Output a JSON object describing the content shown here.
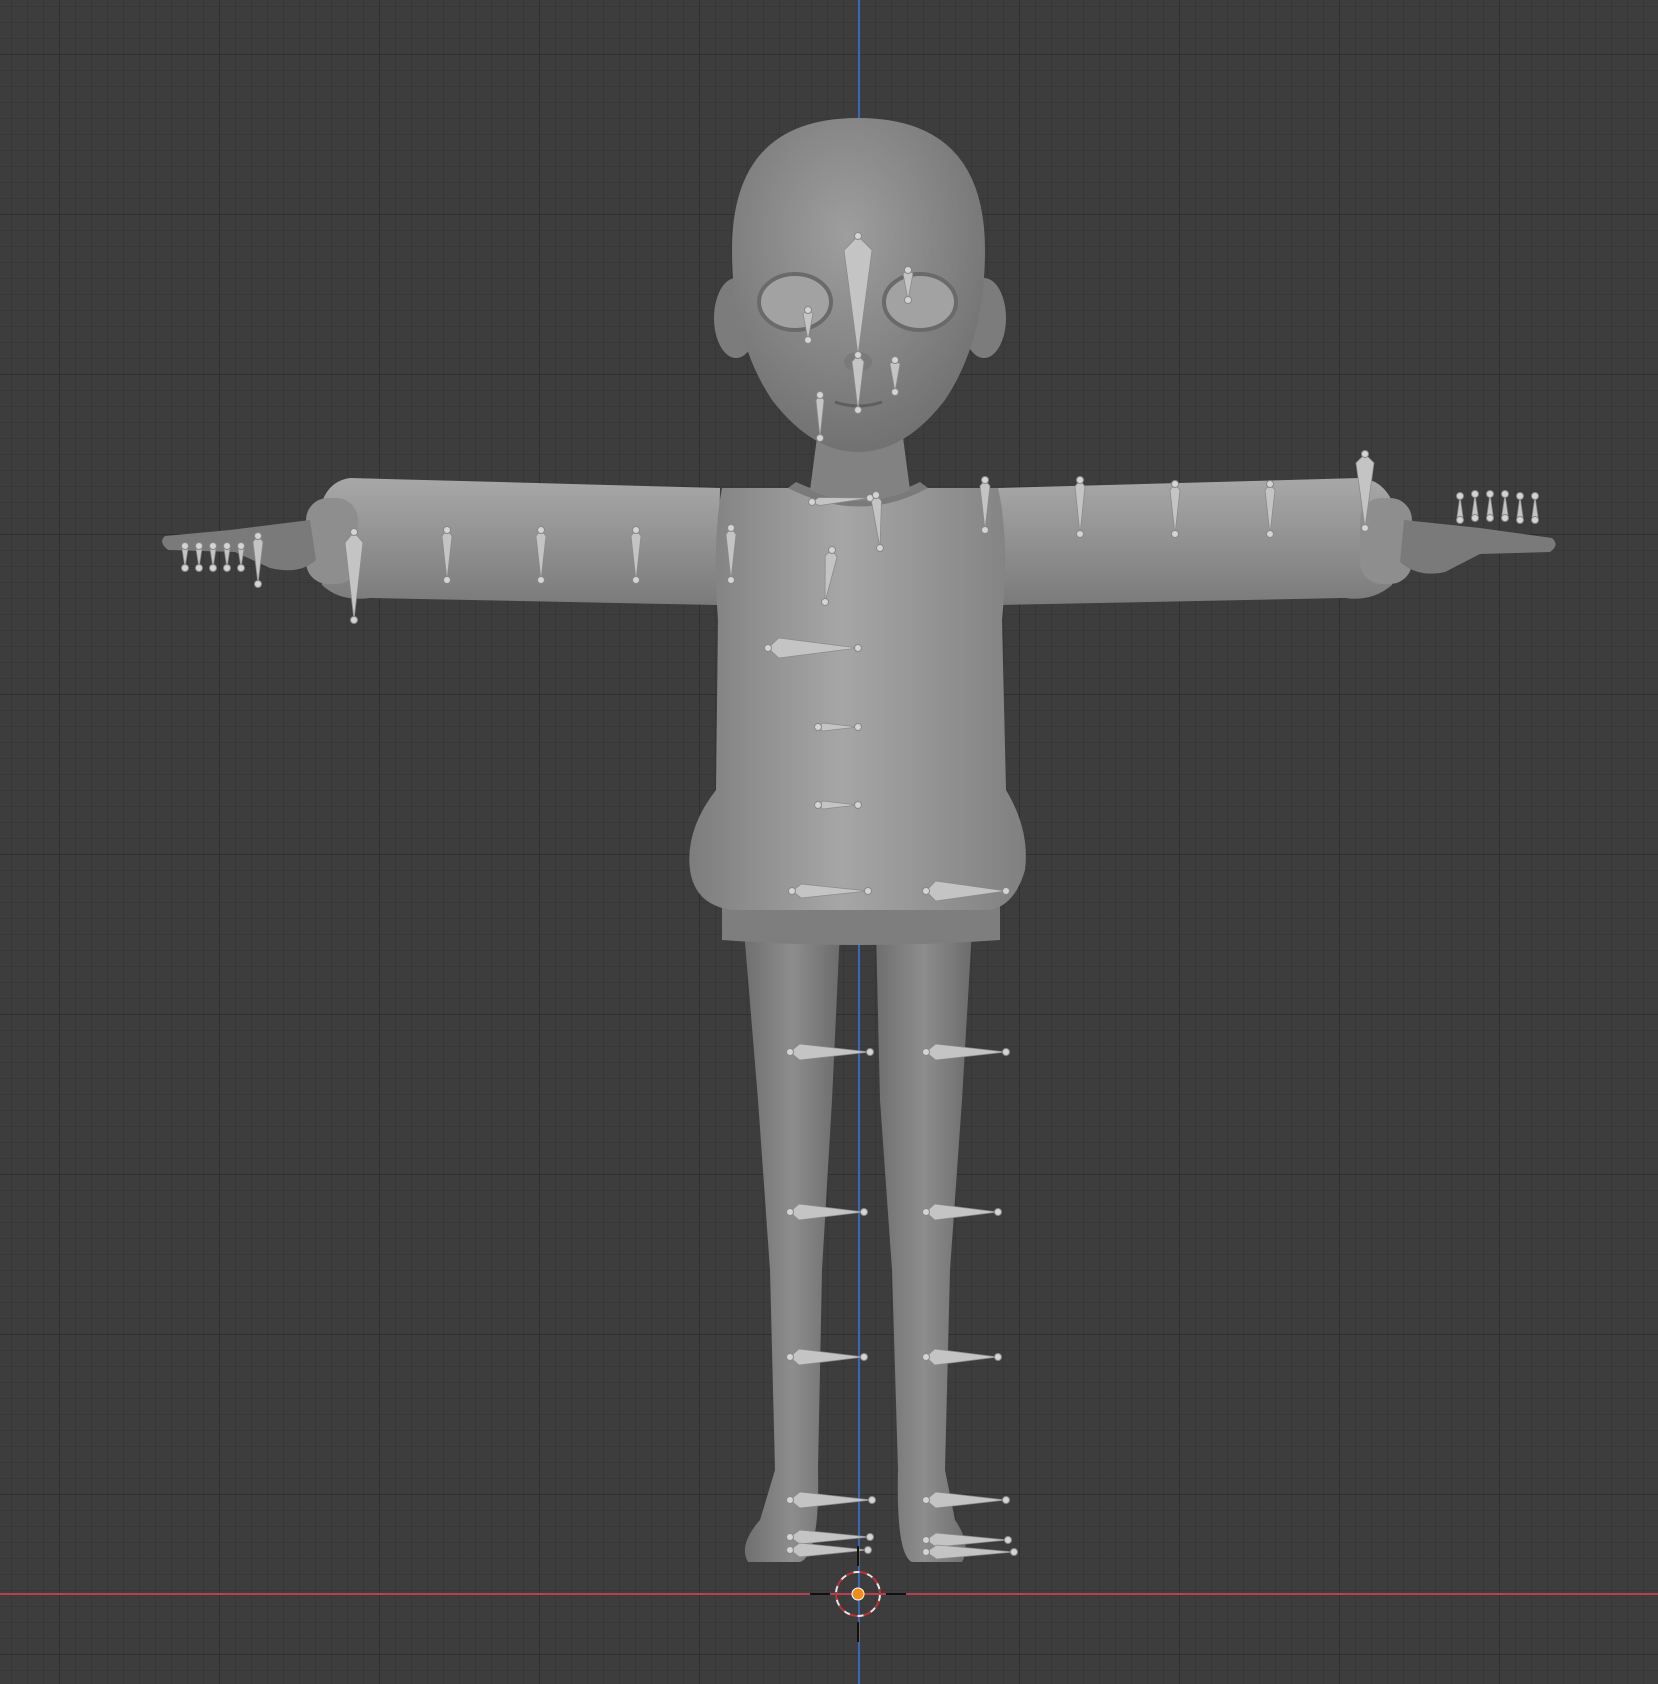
{
  "viewport": {
    "mode": "front-orthographic",
    "colors": {
      "background": "#3d3d3d",
      "axis_x": "#b34352",
      "axis_z": "#3a68b5",
      "cursor_center": "#f08c1a",
      "mesh": "#8f8f8f",
      "bone": "#c4c4c4"
    }
  },
  "objects": [
    {
      "name": "character-mesh",
      "type": "mesh",
      "pose": "T-pose"
    },
    {
      "name": "armature",
      "type": "armature"
    }
  ],
  "icons": [
    "3d-cursor-icon"
  ]
}
